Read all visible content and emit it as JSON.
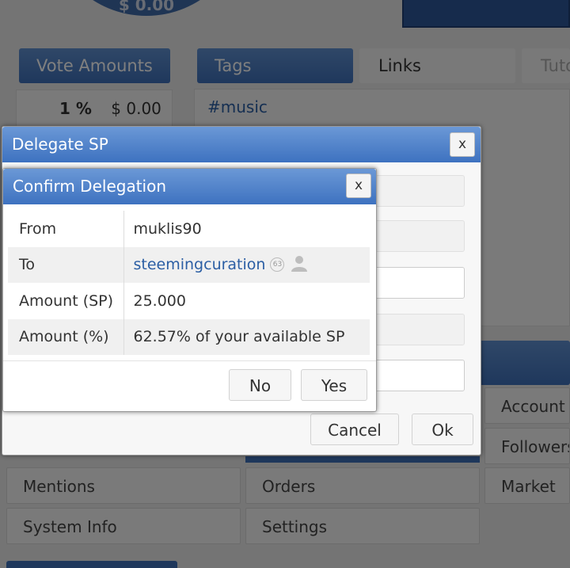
{
  "background": {
    "balance": "$ 0.00",
    "vote_amounts_label": "Vote Amounts",
    "vote_percent": "1 %",
    "vote_value": "$ 0.00",
    "tabs": [
      "Tags",
      "Links",
      "Tuto"
    ],
    "tag": "#music",
    "right_items": [
      "Account D",
      "Followers",
      "Market In"
    ],
    "grid_items": [
      "Mentions",
      "Orders",
      "System Info",
      "Settings"
    ]
  },
  "delegate_dialog": {
    "title": "Delegate SP",
    "close": "x",
    "cancel": "Cancel",
    "ok": "Ok"
  },
  "confirm_dialog": {
    "title": "Confirm Delegation",
    "close": "x",
    "rows": [
      {
        "label": "From",
        "value": "muklis90"
      },
      {
        "label": "To",
        "value": "steemingcuration",
        "reputation": "63"
      },
      {
        "label": "Amount (SP)",
        "value": "25.000"
      },
      {
        "label": "Amount (%)",
        "value": "62.57% of your available SP"
      }
    ],
    "no": "No",
    "yes": "Yes"
  },
  "colors": {
    "title_bar": "#4a7cc7",
    "link": "#2b5ea4",
    "overlay": "rgba(0,0,0,0.5)"
  }
}
